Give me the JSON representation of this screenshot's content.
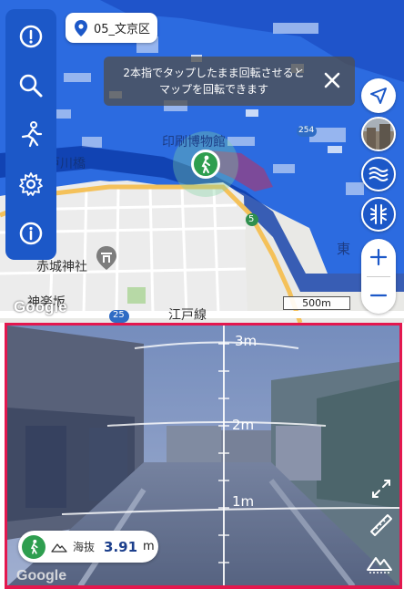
{
  "map": {
    "location_chip": "05_文京区",
    "toast_text": "2本指でタップしたまま回転させると\nマップを回転できます",
    "scale_label": "500m",
    "labels": {
      "edogawabashi": "江戸川橋",
      "akagi_jinja": "赤城神社",
      "kagurazaka": "神楽坂",
      "insatsu_hakubutsukan": "印刷博物館",
      "edogawa_line": "江戸線",
      "route_5": "5",
      "route_25": "25",
      "route_254": "254",
      "higashi": "東"
    },
    "google_logo": "Google"
  },
  "camera": {
    "ruler_labels": [
      "3m",
      "2m",
      "1m"
    ],
    "altitude_label": "海抜",
    "altitude_value": "3.91",
    "altitude_unit": "m",
    "google_logo": "Google"
  },
  "icons": {
    "sidebar": [
      "alert-icon",
      "search-icon",
      "walker-icon",
      "gear-icon",
      "info-icon"
    ],
    "right": [
      "navigation-arrow-icon",
      "street-view-thumbnail",
      "water-waves-icon",
      "railway-icon",
      "zoom-in-icon",
      "zoom-out-icon"
    ],
    "camera": [
      "expand-icon",
      "ruler-icon",
      "terrain-icon"
    ]
  },
  "colors": {
    "sidebar": "#1c58c8",
    "flood_blue": "#1e63d8",
    "accent_green": "#2e9e4f",
    "camera_border": "#e3174e"
  }
}
